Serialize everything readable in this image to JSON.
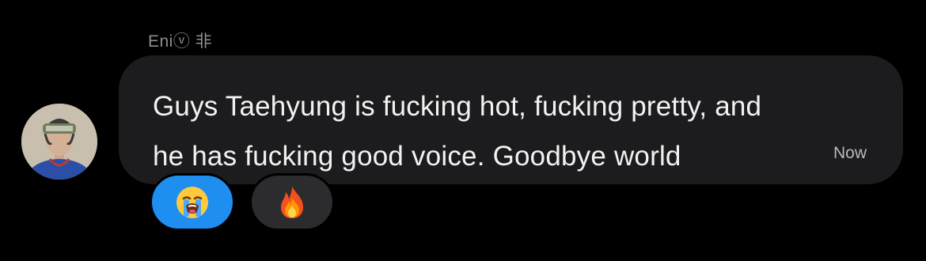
{
  "message": {
    "sender_name": "Eniⓥ 非",
    "text_line1": "Guys Taehyung is fucking hot, fucking pretty, and",
    "text_line2": "he has fucking good voice. Goodbye world",
    "timestamp": "Now",
    "avatar_icon": "profile-photo"
  },
  "reactions": [
    {
      "emoji": "😭",
      "icon": "loudly-crying-face-icon",
      "selected": true
    },
    {
      "emoji": "🔥",
      "icon": "fire-icon",
      "selected": false
    }
  ],
  "colors": {
    "background": "#000000",
    "bubble": "#1c1c1e",
    "selected_reaction": "#1e8ff0",
    "unselected_reaction": "#2c2c2e",
    "sender_name": "#8e8e93",
    "message_text": "#f2f2f2",
    "timestamp": "#b8b8bd"
  }
}
